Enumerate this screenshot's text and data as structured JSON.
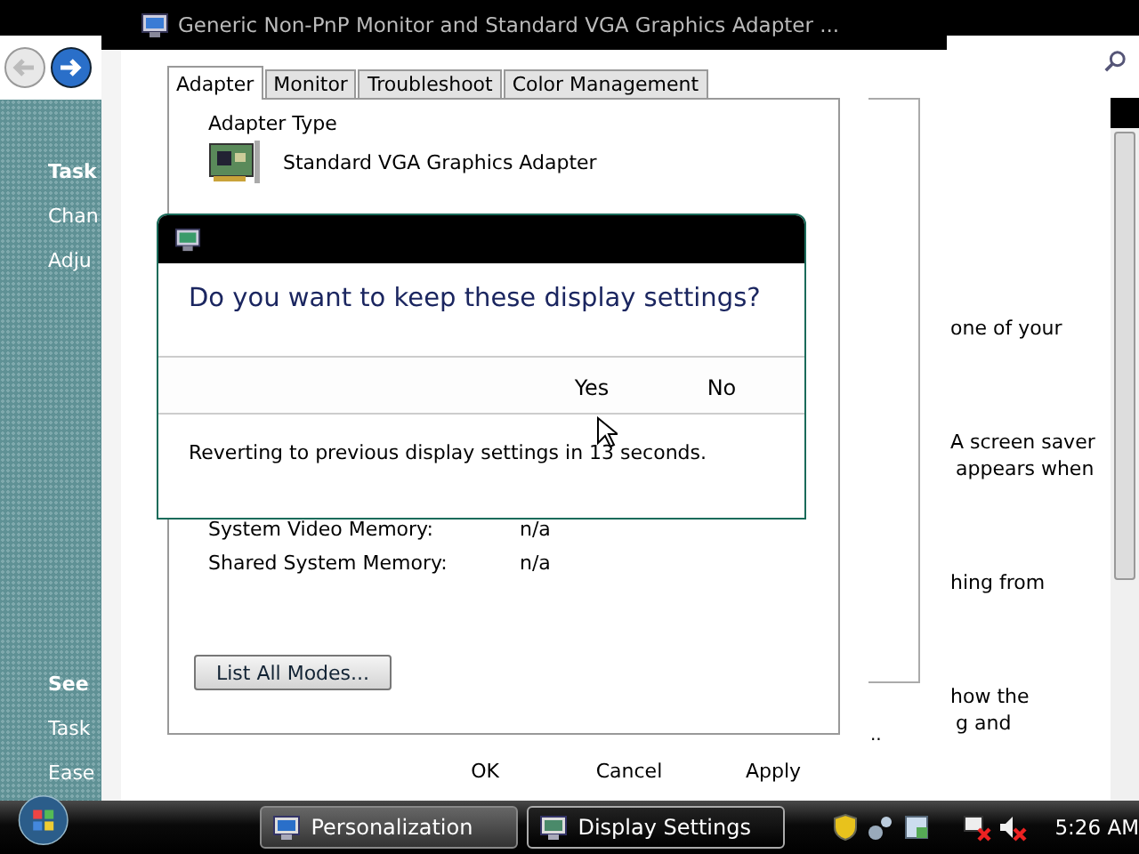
{
  "background_window": {
    "sidebar_items": [
      {
        "label": "Task",
        "kind": "heading"
      },
      {
        "label": "Chan",
        "kind": "link"
      },
      {
        "label": "Adju",
        "kind": "link"
      },
      {
        "label": "See",
        "kind": "heading"
      },
      {
        "label": "Task",
        "kind": "link"
      },
      {
        "label": "Ease",
        "kind": "link"
      }
    ],
    "content_fragments": [
      {
        "text": "one of your"
      },
      {
        "text": "A screen saver"
      },
      {
        "text": "appears when"
      },
      {
        "text": "hing from"
      },
      {
        "text": "how the"
      },
      {
        "text": "g and"
      }
    ],
    "ellipsis": ".."
  },
  "properties_window": {
    "title": "Generic Non-PnP Monitor and Standard VGA Graphics Adapter ...",
    "tabs": [
      {
        "label": "Adapter",
        "selected": true
      },
      {
        "label": "Monitor",
        "selected": false
      },
      {
        "label": "Troubleshoot",
        "selected": false
      },
      {
        "label": "Color Management",
        "selected": false
      }
    ],
    "adapter_type_label": "Adapter Type",
    "adapter_name": "Standard VGA Graphics Adapter",
    "info_rows": [
      {
        "label": "System Video Memory:",
        "value": "n/a"
      },
      {
        "label": "Shared System Memory:",
        "value": "n/a"
      }
    ],
    "list_modes_button": "List All Modes...",
    "buttons": [
      "OK",
      "Cancel",
      "Apply"
    ]
  },
  "dialog": {
    "question": "Do you want to keep these display settings?",
    "buttons": [
      "Yes",
      "No"
    ],
    "countdown": "Reverting to previous display settings in 13 seconds."
  },
  "taskbar": {
    "buttons": [
      {
        "label": "Personalization",
        "selected": false
      },
      {
        "label": "Display Settings",
        "selected": true
      }
    ],
    "clock": "5:26 AM"
  }
}
